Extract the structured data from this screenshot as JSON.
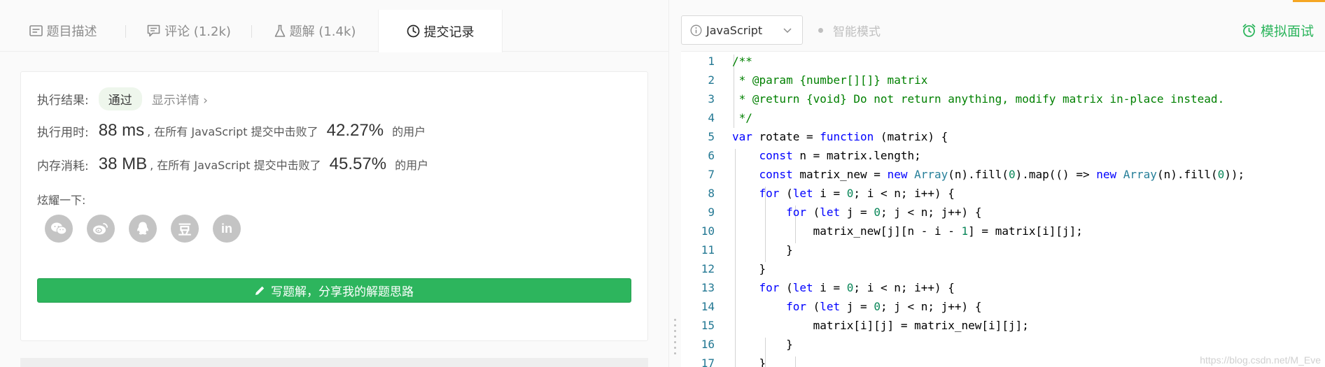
{
  "tabs": [
    {
      "label": "题目描述",
      "icon": "description-icon"
    },
    {
      "label": "评论 (1.2k)",
      "icon": "comment-icon"
    },
    {
      "label": "题解 (1.4k)",
      "icon": "flask-icon"
    },
    {
      "label": "提交记录",
      "icon": "clock-icon"
    }
  ],
  "result": {
    "label": "执行结果:",
    "status": "通过",
    "detail_link": "显示详情 ›"
  },
  "runtime": {
    "label": "执行用时:",
    "value": "88 ms",
    "middle": ", 在所有 JavaScript 提交中击败了",
    "percent": "42.27%",
    "suffix": "的用户"
  },
  "memory": {
    "label": "内存消耗:",
    "value": "38 MB",
    "middle": ", 在所有 JavaScript 提交中击败了",
    "percent": "45.57%",
    "suffix": "的用户"
  },
  "share": {
    "label": "炫耀一下:",
    "icons": [
      "wechat-icon",
      "weibo-icon",
      "qq-icon",
      "douban-icon",
      "linkedin-icon"
    ],
    "douban_glyph": "豆",
    "linkedin_glyph": "in"
  },
  "write_button": "写题解，分享我的解题思路",
  "editor_toolbar": {
    "language": "JavaScript",
    "smart_mode": "智能模式",
    "mock_interview": "模拟面试"
  },
  "code_lines": [
    {
      "n": "1",
      "text": "/**"
    },
    {
      "n": "2",
      "text": " * @param {number[][]} matrix"
    },
    {
      "n": "3",
      "text": " * @return {void} Do not return anything, modify matrix in-place instead."
    },
    {
      "n": "4",
      "text": " */"
    },
    {
      "n": "5",
      "text": "var rotate = function (matrix) {"
    },
    {
      "n": "6",
      "text": "    const n = matrix.length;"
    },
    {
      "n": "7",
      "text": "    const matrix_new = new Array(n).fill(0).map(() => new Array(n).fill(0));"
    },
    {
      "n": "8",
      "text": "    for (let i = 0; i < n; i++) {"
    },
    {
      "n": "9",
      "text": "        for (let j = 0; j < n; j++) {"
    },
    {
      "n": "10",
      "text": "            matrix_new[j][n - i - 1] = matrix[i][j];"
    },
    {
      "n": "11",
      "text": "        }"
    },
    {
      "n": "12",
      "text": "    }"
    },
    {
      "n": "13",
      "text": "    for (let i = 0; i < n; i++) {"
    },
    {
      "n": "14",
      "text": "        for (let j = 0; j < n; j++) {"
    },
    {
      "n": "15",
      "text": "            matrix[i][j] = matrix_new[i][j];"
    },
    {
      "n": "16",
      "text": "        }"
    },
    {
      "n": "17",
      "text": "    }"
    }
  ],
  "watermark": "https://blog.csdn.net/M_Eve",
  "colors": {
    "accent_green": "#2db55d",
    "code_comment": "#008000",
    "code_keyword": "#0000ff",
    "code_number": "#098658",
    "line_number": "#237893"
  }
}
